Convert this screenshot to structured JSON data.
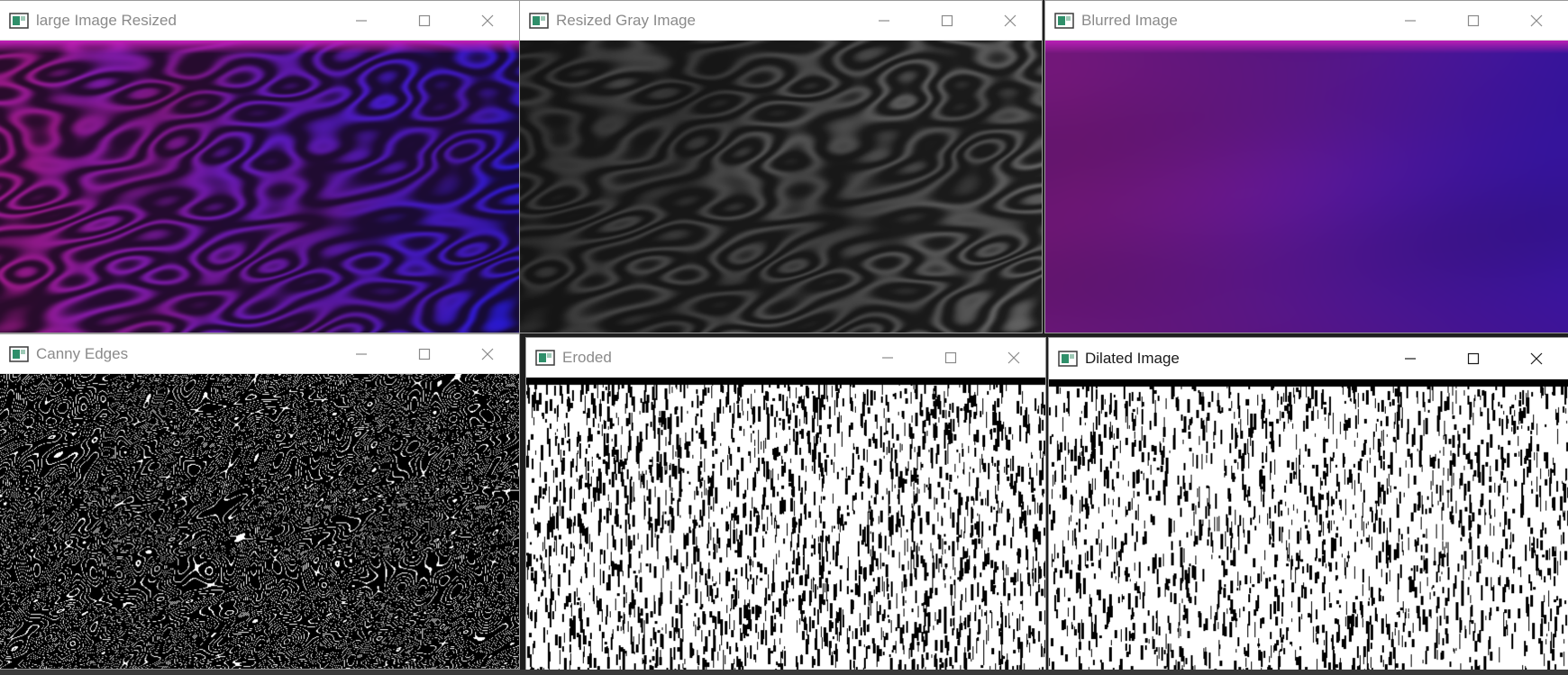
{
  "windows": [
    {
      "id": "large-image-resized",
      "title": "large Image Resized",
      "active": false,
      "content_kind": "color-swirl",
      "colors": {
        "dark": "#120818",
        "magenta": "#b01c9c",
        "violet": "#5a1ac8",
        "blue": "#2a1ae0",
        "top_band": "#c21fb8"
      }
    },
    {
      "id": "resized-gray-image",
      "title": "Resized Gray Image",
      "active": false,
      "content_kind": "gray-swirl",
      "colors": {
        "dark": "#0e0e0e",
        "mid": "#3a3a3a",
        "light": "#6a6a6a"
      }
    },
    {
      "id": "blurred-image",
      "title": "Blurred Image",
      "active": false,
      "content_kind": "blurred",
      "colors": {
        "dark": "#2a0a3a",
        "magenta": "#9a1f9c",
        "blue": "#3a18c8",
        "top_band": "#b81fb5"
      }
    },
    {
      "id": "canny-edges",
      "title": "Canny Edges",
      "active": false,
      "content_kind": "edges",
      "colors": {
        "bg": "#000000",
        "fg": "#ffffff"
      }
    },
    {
      "id": "eroded",
      "title": "Eroded",
      "active": false,
      "content_kind": "binary-streaks",
      "colors": {
        "bg": "#000000",
        "fg": "#ffffff"
      }
    },
    {
      "id": "dilated-image",
      "title": "Dilated Image",
      "active": true,
      "content_kind": "binary-streaks-dense",
      "colors": {
        "bg": "#000000",
        "fg": "#ffffff"
      }
    }
  ],
  "icons": {
    "app": "app-window-icon",
    "minimize": "minimize-icon",
    "maximize": "maximize-icon",
    "close": "close-icon"
  },
  "chrome_colors": {
    "icon_green": "#2f8f6a",
    "icon_frame": "#3b3b3b",
    "inactive_glyph": "#8a8a8a",
    "active_glyph": "#1a1a1a"
  }
}
